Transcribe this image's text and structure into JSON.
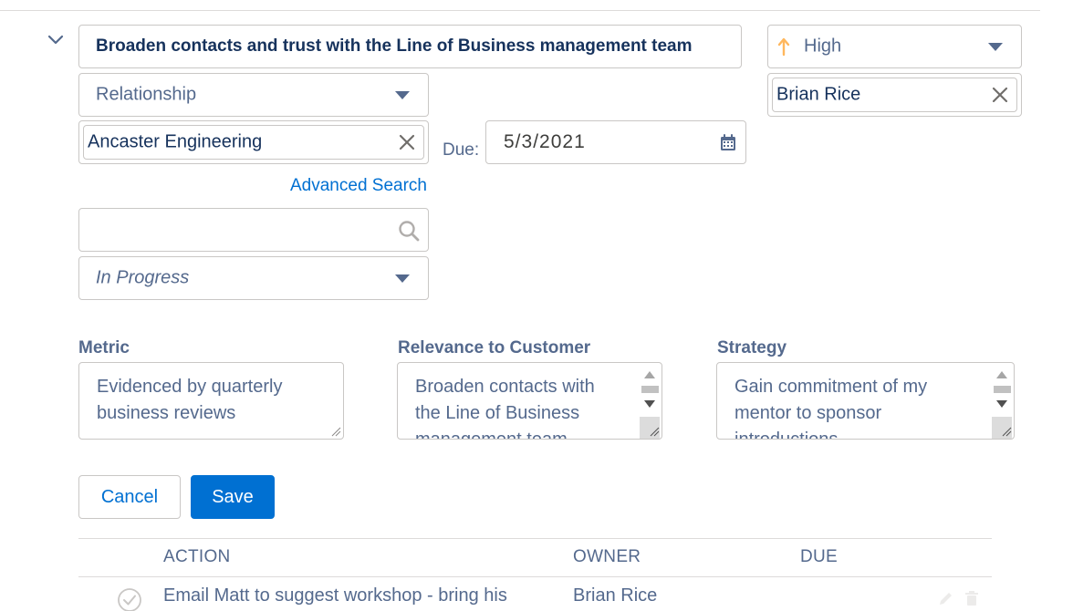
{
  "goal": {
    "title": "Broaden contacts and trust with the Line of Business management team",
    "priority": "High",
    "owner": "Brian Rice",
    "type": "Relationship",
    "account": "Ancaster Engineering",
    "due_label": "Due:",
    "due_date": "5/3/2021",
    "advanced_search": "Advanced Search",
    "search_placeholder": "",
    "status": "In Progress"
  },
  "details": {
    "metric_label": "Metric",
    "metric_value": "Evidenced by quarterly business reviews",
    "relevance_label": "Relevance to Customer",
    "relevance_value": "Broaden contacts with the Line of Business management team",
    "strategy_label": "Strategy",
    "strategy_value": "Gain commitment of my mentor to sponsor introductions"
  },
  "buttons": {
    "cancel": "Cancel",
    "save": "Save"
  },
  "actions_table": {
    "columns": [
      "ACTION",
      "OWNER",
      "DUE"
    ],
    "rows": [
      {
        "action": "Email Matt to suggest workshop - bring his",
        "owner": "Brian Rice",
        "due": ""
      }
    ]
  },
  "colors": {
    "brand_blue": "#0070d2",
    "title_navy": "#16325c",
    "muted_text": "#54698d",
    "priority_arrow": "#ffb75d",
    "border": "#c9c7c5"
  },
  "icons": [
    "chevron-down-icon",
    "arrow-up-icon",
    "caret-down-icon",
    "close-icon",
    "calendar-icon",
    "search-icon",
    "check-circle-icon",
    "edit-icon",
    "delete-icon"
  ]
}
